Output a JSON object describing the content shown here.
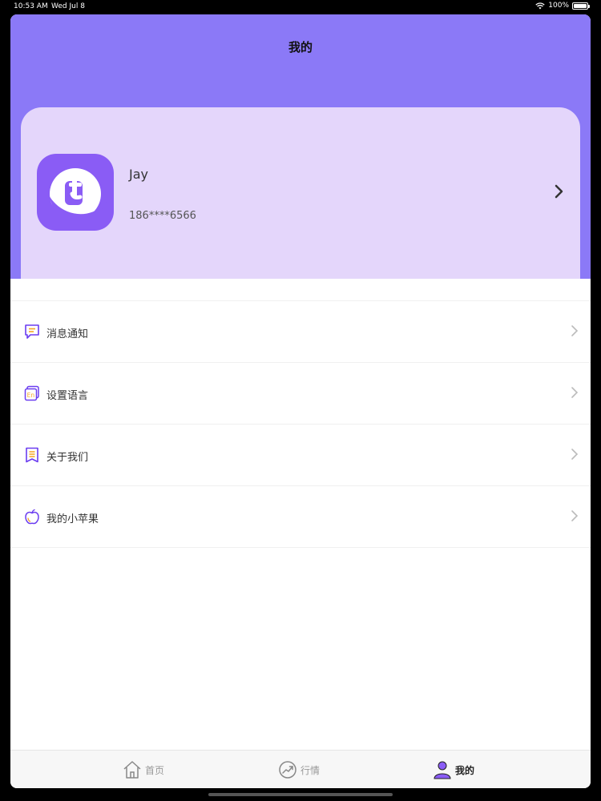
{
  "status_bar": {
    "time": "10:53 AM",
    "date": "Wed Jul 8",
    "battery": "100%",
    "icons": [
      "wifi-icon",
      "battery-icon"
    ]
  },
  "header": {
    "title": "我的",
    "background_color": "#8b79f7"
  },
  "profile": {
    "name": "Jay",
    "phone": "186****6566",
    "card_color": "#e4d6fb",
    "avatar_color": "#8a5cf5",
    "chevron_icon": "chevron-right-icon"
  },
  "menu": {
    "items": [
      {
        "label": "消息通知",
        "icon": "message-icon"
      },
      {
        "label": "设置语言",
        "icon": "language-icon"
      },
      {
        "label": "关于我们",
        "icon": "about-book-icon"
      },
      {
        "label": "我的小苹果",
        "icon": "apple-icon"
      }
    ],
    "icon_color": "#6b3df0",
    "accent_color": "#f5a623"
  },
  "tab_bar": {
    "tabs": [
      {
        "label": "首页",
        "icon": "home-icon",
        "active": false
      },
      {
        "label": "行情",
        "icon": "trend-icon",
        "active": false
      },
      {
        "label": "我的",
        "icon": "user-icon",
        "active": true
      }
    ]
  }
}
